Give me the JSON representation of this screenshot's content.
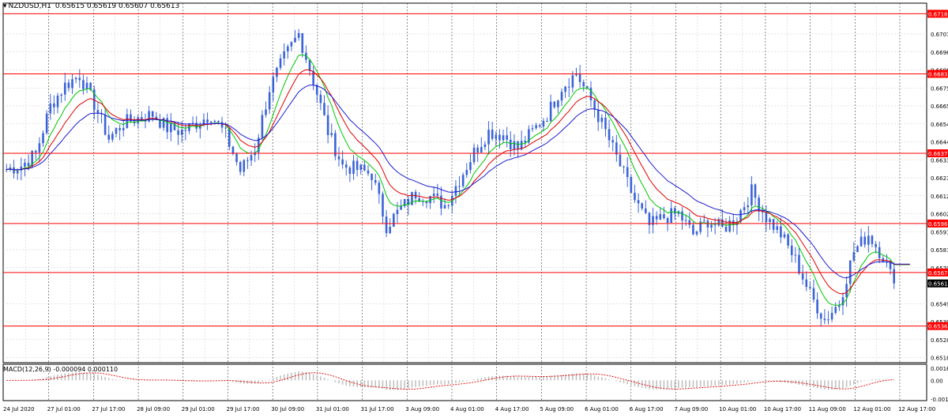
{
  "header": {
    "arrow": "▾",
    "symbol": "NZDUSD,H1",
    "ohlc": "0.65615 0.65619 0.65607 0.65613"
  },
  "macd_header": {
    "label": "MACD(12,26,9)",
    "values": "-0.000094 0.000110"
  },
  "colors": {
    "background": "#ffffff",
    "grid": "#c8c8c8",
    "candle": "#3a63d8",
    "ma_fast": "#00c800",
    "ma_mid": "#e00000",
    "ma_slow": "#1c1cd0",
    "level_line": "#ff0000",
    "macd_hist": "#c0c0c0",
    "macd_signal": "#e00000",
    "price_tag": "#000000"
  },
  "chart_data": {
    "type": "candlestick",
    "symbol": "NZDUSD",
    "timeframe": "H1",
    "x_labels": [
      "24 Jul 2020",
      "27 Jul 01:00",
      "27 Jul 17:00",
      "28 Jul 09:00",
      "29 Jul 01:00",
      "29 Jul 17:00",
      "30 Jul 09:00",
      "31 Jul 01:00",
      "31 Jul 17:00",
      "3 Aug 09:00",
      "4 Aug 01:00",
      "4 Aug 17:00",
      "5 Aug 09:00",
      "6 Aug 01:00",
      "6 Aug 17:00",
      "7 Aug 09:00",
      "10 Aug 01:00",
      "10 Aug 17:00",
      "11 Aug 09:00",
      "12 Aug 01:00",
      "12 Aug 17:00"
    ],
    "y_ticks": [
      "0.67070",
      "0.66965",
      "0.66860",
      "0.66755",
      "0.66650",
      "0.66545",
      "0.66440",
      "0.66335",
      "0.66230",
      "0.66125",
      "0.66020",
      "0.65915",
      "0.65810",
      "0.65705",
      "0.65495",
      "0.65390",
      "0.65285",
      "0.65180"
    ],
    "ylim": [
      0.6515,
      0.6725
    ],
    "levels": [
      "0.67188",
      "0.66837",
      "0.66373",
      "0.65963",
      "0.65677",
      "0.65364"
    ],
    "current_price": "0.65613",
    "close_path": [
      [
        0,
        0.6628
      ],
      [
        4,
        0.663
      ],
      [
        8,
        0.6637
      ],
      [
        12,
        0.6665
      ],
      [
        16,
        0.6677
      ],
      [
        20,
        0.6683
      ],
      [
        24,
        0.6666
      ],
      [
        28,
        0.6646
      ],
      [
        32,
        0.6655
      ],
      [
        36,
        0.6658
      ],
      [
        40,
        0.666
      ],
      [
        44,
        0.6652
      ],
      [
        48,
        0.665
      ],
      [
        52,
        0.6655
      ],
      [
        56,
        0.666
      ],
      [
        60,
        0.6648
      ],
      [
        64,
        0.6627
      ],
      [
        68,
        0.664
      ],
      [
        72,
        0.6675
      ],
      [
        76,
        0.6693
      ],
      [
        80,
        0.6707
      ],
      [
        84,
        0.668
      ],
      [
        88,
        0.665
      ],
      [
        92,
        0.663
      ],
      [
        96,
        0.6628
      ],
      [
        100,
        0.6625
      ],
      [
        104,
        0.6595
      ],
      [
        108,
        0.6605
      ],
      [
        112,
        0.6614
      ],
      [
        116,
        0.6612
      ],
      [
        120,
        0.6607
      ],
      [
        124,
        0.6622
      ],
      [
        128,
        0.6638
      ],
      [
        132,
        0.665
      ],
      [
        136,
        0.6648
      ],
      [
        140,
        0.664
      ],
      [
        144,
        0.665
      ],
      [
        148,
        0.666
      ],
      [
        152,
        0.6676
      ],
      [
        156,
        0.6684
      ],
      [
        160,
        0.6668
      ],
      [
        164,
        0.665
      ],
      [
        168,
        0.663
      ],
      [
        172,
        0.661
      ],
      [
        176,
        0.6595
      ],
      [
        180,
        0.66
      ],
      [
        184,
        0.6602
      ],
      [
        188,
        0.659
      ],
      [
        192,
        0.6598
      ],
      [
        196,
        0.6593
      ],
      [
        200,
        0.66
      ],
      [
        204,
        0.6615
      ],
      [
        208,
        0.66
      ],
      [
        212,
        0.659
      ],
      [
        216,
        0.6575
      ],
      [
        220,
        0.6555
      ],
      [
        224,
        0.654
      ],
      [
        228,
        0.655
      ],
      [
        232,
        0.658
      ],
      [
        236,
        0.659
      ],
      [
        240,
        0.6577
      ],
      [
        243,
        0.65613
      ]
    ],
    "n_bars": 244,
    "indicators": [
      {
        "name": "MA fast",
        "period_note": "",
        "color_key": "ma_fast"
      },
      {
        "name": "MA mid",
        "period_note": "",
        "color_key": "ma_mid"
      },
      {
        "name": "MA slow",
        "period_note": "",
        "color_key": "ma_slow"
      }
    ],
    "macd": {
      "y_ticks": [
        "0.001615",
        "0.00",
        "-0.00194"
      ],
      "ylim": [
        -0.00205,
        0.0017
      ]
    },
    "grid": true
  }
}
